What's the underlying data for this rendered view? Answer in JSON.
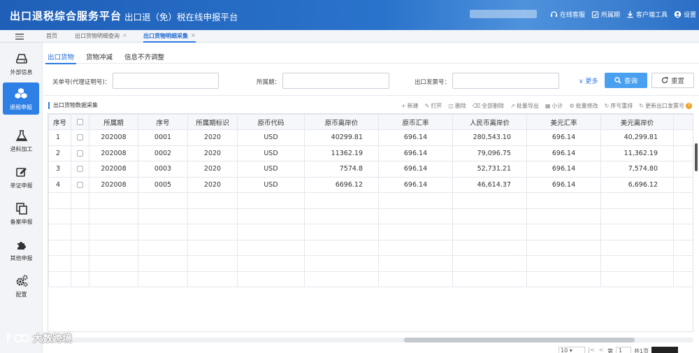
{
  "header": {
    "brand": "出口退税综合服务平台",
    "subtitle": "出口退（免）税在线申报平台",
    "links": [
      {
        "label": "在线客服",
        "icon": "headset-icon"
      },
      {
        "label": "所属期",
        "icon": "calendar-check-icon"
      },
      {
        "label": "客户端工具",
        "icon": "download-icon"
      },
      {
        "label": "设置",
        "icon": "user-circle-icon"
      }
    ]
  },
  "tabs": [
    {
      "label": "首页",
      "closable": false
    },
    {
      "label": "出口货物明细查询",
      "closable": true
    },
    {
      "label": "出口货物明细采集",
      "closable": true,
      "active": true
    }
  ],
  "sidebar": {
    "items": [
      {
        "label": "外部信息",
        "icon": "hard-drive-icon"
      },
      {
        "label": "退税申报",
        "icon": "cubes-icon",
        "active": true
      },
      {
        "label": "进料加工",
        "icon": "flask-icon"
      },
      {
        "label": "单证申报",
        "icon": "edit-icon"
      },
      {
        "label": "备案申报",
        "icon": "copy-icon"
      },
      {
        "label": "其他申报",
        "icon": "puzzle-icon"
      },
      {
        "label": "配置",
        "icon": "gears-icon"
      }
    ]
  },
  "subtabs": [
    {
      "label": "出口货物",
      "active": true
    },
    {
      "label": "货物冲减"
    },
    {
      "label": "信息不齐调整"
    }
  ],
  "filters": {
    "customs_no_label": "关单号(代理证明号)：",
    "period_label": "所属期：",
    "invoice_label": "出口发票号：",
    "more_label": "更多",
    "query_label": "查询",
    "reset_label": "重置"
  },
  "section_title": "出口货物数据采集",
  "toolbar": [
    {
      "label": "新建",
      "icon": "plus-icon"
    },
    {
      "label": "打开",
      "icon": "edit-icon"
    },
    {
      "label": "删除",
      "icon": "trash-icon"
    },
    {
      "label": "全部删除",
      "icon": "eraser-icon"
    },
    {
      "label": "批量导出",
      "icon": "export-icon"
    },
    {
      "label": "小计",
      "icon": "calculator-icon"
    },
    {
      "label": "批量修改",
      "icon": "gears-icon"
    },
    {
      "label": "序号重排",
      "icon": "refresh-icon"
    },
    {
      "label": "更新出口发票号",
      "icon": "refresh-icon"
    }
  ],
  "table": {
    "columns": [
      "序号",
      "",
      "所属期",
      "序号",
      "所属期标识",
      "原币代码",
      "原币离岸价",
      "原币汇率",
      "人民币离岸价",
      "美元汇率",
      "美元离岸价"
    ],
    "rows": [
      [
        "1",
        "",
        "202008",
        "0001",
        "2020",
        "USD",
        "40299.81",
        "696.14",
        "280,543.10",
        "696.14",
        "40,299.81"
      ],
      [
        "2",
        "",
        "202008",
        "0002",
        "2020",
        "USD",
        "11362.19",
        "696.14",
        "79,096.75",
        "696.14",
        "11,362.19"
      ],
      [
        "3",
        "",
        "202008",
        "0003",
        "2020",
        "USD",
        "7574.8",
        "696.14",
        "52,731.21",
        "696.14",
        "7,574.80"
      ],
      [
        "4",
        "",
        "202008",
        "0005",
        "2020",
        "USD",
        "6696.12",
        "696.14",
        "46,614.37",
        "696.14",
        "6,696.12"
      ]
    ]
  },
  "pager": {
    "page_size": "10",
    "page_label": "第",
    "page_value": "1",
    "total_label": "共1页"
  },
  "watermark": "大数跨境"
}
